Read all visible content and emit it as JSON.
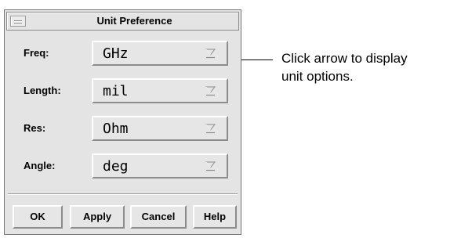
{
  "dialog": {
    "title": "Unit Preference",
    "rows": [
      {
        "label": "Freq:",
        "value": "GHz"
      },
      {
        "label": "Length:",
        "value": "mil"
      },
      {
        "label": "Res:",
        "value": "Ohm"
      },
      {
        "label": "Angle:",
        "value": "deg"
      }
    ],
    "buttons": {
      "ok": "OK",
      "apply": "Apply",
      "cancel": "Cancel",
      "help": "Help"
    }
  },
  "callout": {
    "line1": "Click arrow to display",
    "line2": "unit options."
  },
  "colors": {
    "dialog_bg": "#e4e4e4",
    "bevel_light": "#ffffff",
    "bevel_dark": "#8c8c8c"
  },
  "icons": [
    "window-menu-icon",
    "dropdown-arrow-icon"
  ]
}
